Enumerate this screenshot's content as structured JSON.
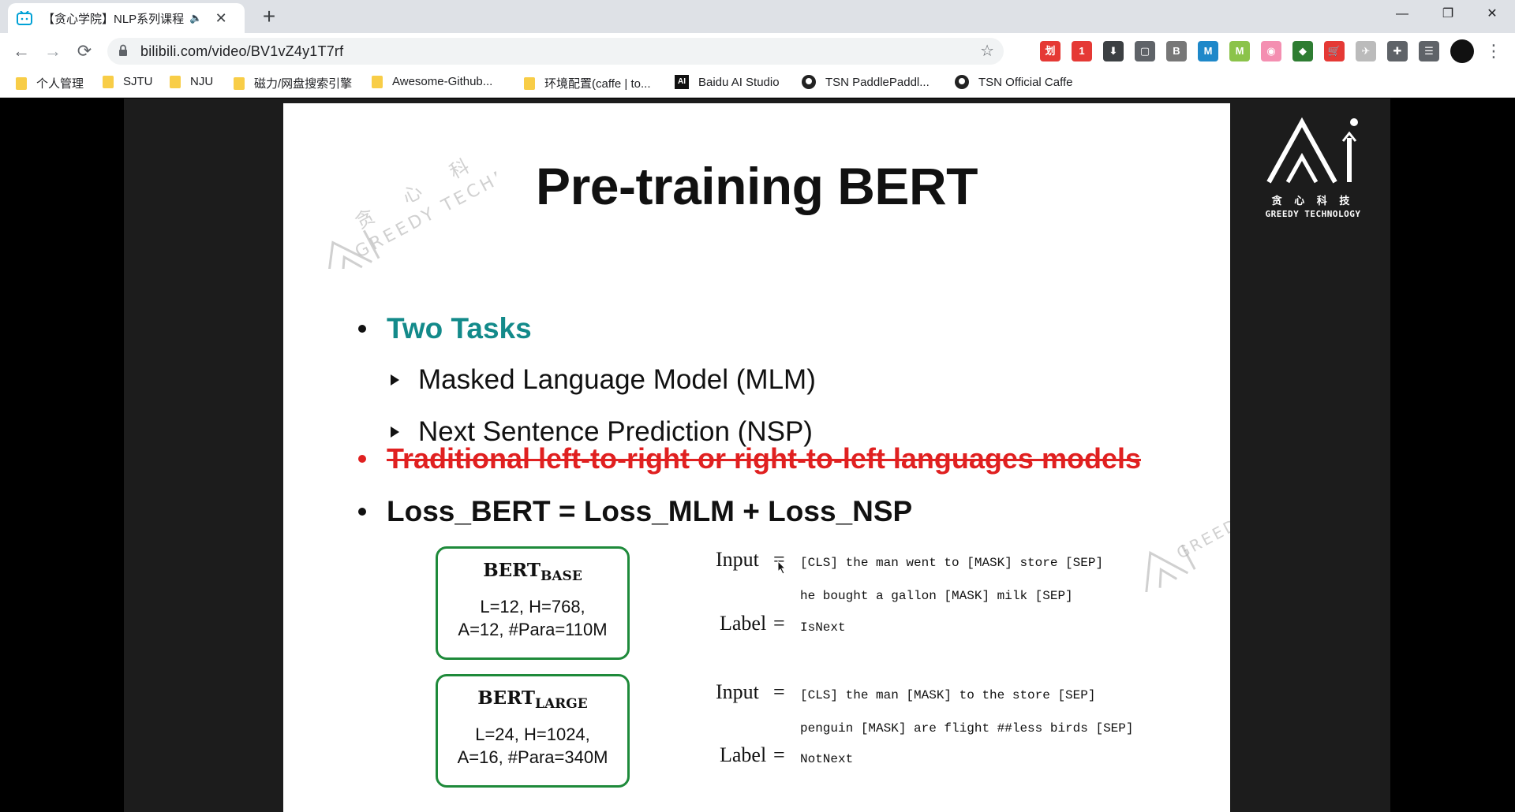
{
  "tab": {
    "title": "【贪心学院】NLP系列课程：",
    "audio_icon": "🔈",
    "close": "✕",
    "new_tab": "+"
  },
  "window": {
    "minimize": "—",
    "restore": "❐",
    "close": "✕"
  },
  "nav": {
    "back": "←",
    "forward": "→",
    "reload": "⟳"
  },
  "address": {
    "url": "bilibili.com/video/BV1vZ4y1T7rf",
    "star": "☆"
  },
  "extensions": [
    {
      "name": "ext-red",
      "color": "#e53935",
      "glyph": "划"
    },
    {
      "name": "ext-badge",
      "color": "#e53935",
      "glyph": "1"
    },
    {
      "name": "ext-download",
      "color": "#3c4043",
      "glyph": "⬇"
    },
    {
      "name": "ext-console",
      "color": "#5f6368",
      "glyph": "▢"
    },
    {
      "name": "ext-base64",
      "color": "#777777",
      "glyph": "B"
    },
    {
      "name": "ext-m-blue",
      "color": "#1e88c9",
      "glyph": "M"
    },
    {
      "name": "ext-m-green",
      "color": "#8bc34a",
      "glyph": "M"
    },
    {
      "name": "ext-bili",
      "color": "#f48fb1",
      "glyph": "◉"
    },
    {
      "name": "ext-color",
      "color": "#2e7d32",
      "glyph": "◆"
    },
    {
      "name": "ext-cart",
      "color": "#e53935",
      "glyph": "🛒"
    },
    {
      "name": "ext-bird",
      "color": "#bbbbbb",
      "glyph": "✈"
    },
    {
      "name": "ext-puzzle",
      "color": "#5f6368",
      "glyph": "✚"
    },
    {
      "name": "ext-playlist",
      "color": "#5f6368",
      "glyph": "☰"
    }
  ],
  "menu": "⋮",
  "bookmarks": [
    {
      "label": "个人管理",
      "type": "folder"
    },
    {
      "label": "SJTU",
      "type": "folder"
    },
    {
      "label": "NJU",
      "type": "folder"
    },
    {
      "label": "磁力/网盘搜索引擎",
      "type": "folder"
    },
    {
      "label": "Awesome-Github...",
      "type": "folder"
    },
    {
      "label": "环境配置(caffe | to...",
      "type": "folder"
    },
    {
      "label": "Baidu AI Studio",
      "type": "ai",
      "badge": "AI"
    },
    {
      "label": "TSN PaddlePaddl...",
      "type": "github"
    },
    {
      "label": "TSN Official Caffe",
      "type": "github"
    }
  ],
  "slide": {
    "title": "Pre-training BERT",
    "bullet1": "Two Tasks",
    "sub1": "Masked Language Model (MLM)",
    "sub2": "Next Sentence Prediction (NSP)",
    "bullet2": "Traditional left-to-right or right-to-left languages models",
    "bullet3": "Loss_BERT = Loss_MLM + Loss_NSP",
    "base": {
      "name": "BERT",
      "sub": "BASE",
      "line1": "L=12, H=768,",
      "line2": "A=12, #Para=110M"
    },
    "large": {
      "name": "BERT",
      "sub": "LARGE",
      "line1": "L=24, H=1024,",
      "line2": "A=16, #Para=340M"
    },
    "ex1": {
      "input_label": "Input",
      "label_label": "Label",
      "eq": "=",
      "input1": "[CLS] the man went to [MASK] store [SEP]",
      "input2": "he bought a gallon [MASK] milk [SEP]",
      "label": "IsNext"
    },
    "ex2": {
      "input_label": "Input",
      "label_label": "Label",
      "eq": "=",
      "input1": "[CLS] the man [MASK] to the store [SEP]",
      "input2": "penguin [MASK] are flight ##less birds [SEP]",
      "label": "NotNext"
    }
  },
  "watermark": {
    "cn": "贪 心 科 技",
    "en": "GREEDY TECHNOLOGY"
  },
  "logo": {
    "cn": "贪 心 科 技",
    "en": "GREEDY TECHNOLOGY"
  }
}
